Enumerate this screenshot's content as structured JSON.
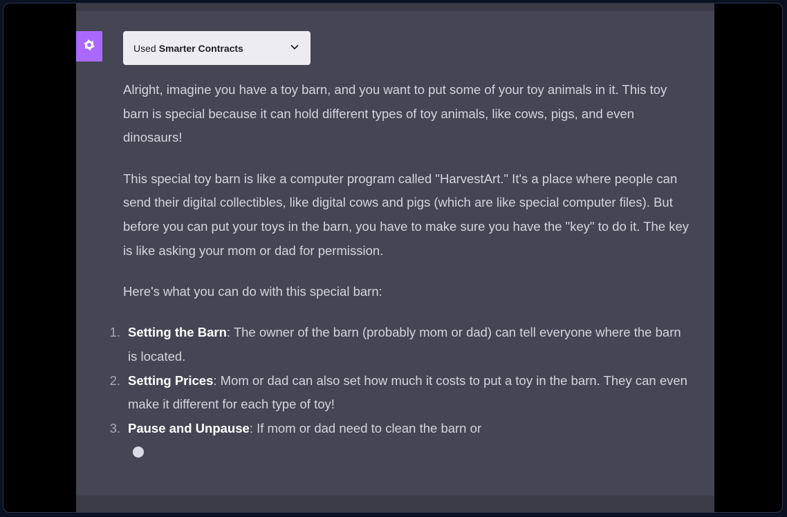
{
  "plugin": {
    "prefix": "Used",
    "name": "Smarter Contracts",
    "chevron_icon": "chevron-down-icon"
  },
  "avatar": {
    "icon": "openai-logo-icon",
    "color": "#ab68ff"
  },
  "message": {
    "paragraphs": [
      "Alright, imagine you have a toy barn, and you want to put some of your toy animals in it. This toy barn is special because it can hold different types of toy animals, like cows, pigs, and even dinosaurs!",
      "This special toy barn is like a computer program called \"HarvestArt.\" It's a place where people can send their digital collectibles, like digital cows and pigs (which are like special computer files). But before you can put your toys in the barn, you have to make sure you have the \"key\" to do it. The key is like asking your mom or dad for permission.",
      "Here's what you can do with this special barn:"
    ],
    "list": [
      {
        "number": "1.",
        "title": "Setting the Barn",
        "text": ": The owner of the barn (probably mom or dad) can tell everyone where the barn is located."
      },
      {
        "number": "2.",
        "title": "Setting Prices",
        "text": ": Mom or dad can also set how much it costs to put a toy in the barn. They can even make it different for each type of toy!"
      },
      {
        "number": "3.",
        "title": "Pause and Unpause",
        "text": ": If mom or dad need to clean the barn or"
      }
    ]
  },
  "colors": {
    "panel_bg": "#444654",
    "text": "#d1d5db",
    "bold_text": "#ffffff",
    "pill_bg": "#ececf1"
  }
}
